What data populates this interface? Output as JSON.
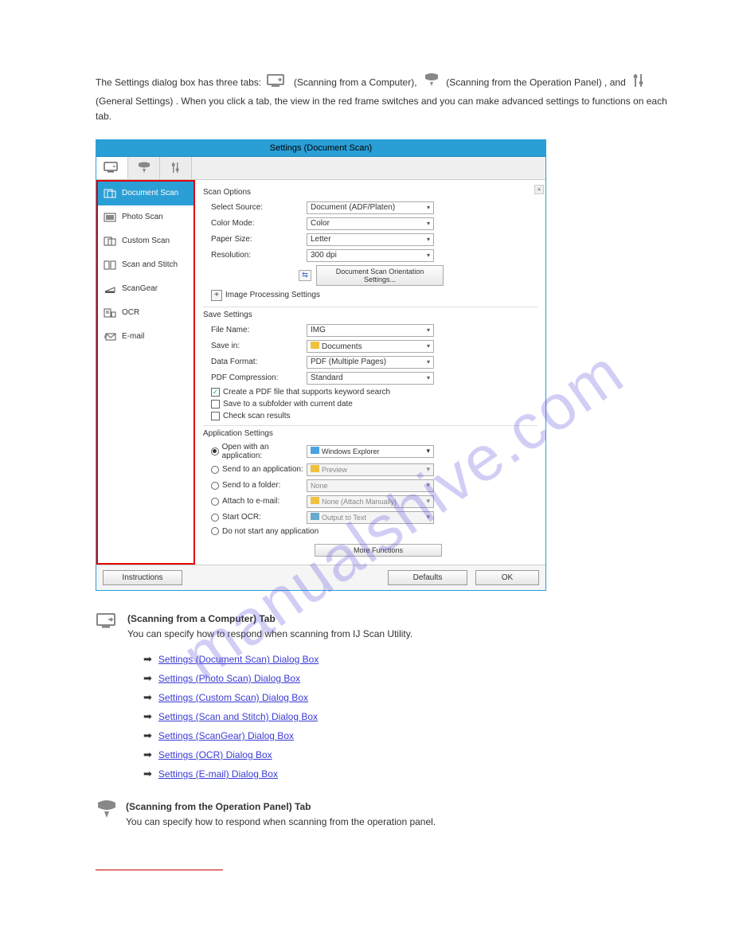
{
  "intro": {
    "text_before": "The Settings dialog box has three tabs:",
    "tab1_label": "(Scanning from a Computer)",
    "tab2_label": "(Scanning from the Operation Panel)",
    "tab3_label": "(General Settings)",
    "text_after": ". When you click a tab, the view in the red frame switches and you can make advanced settings to functions on each tab.",
    "and": ", and"
  },
  "dialog": {
    "title": "Settings (Document Scan)",
    "sidebar": [
      {
        "label": "Document Scan"
      },
      {
        "label": "Photo Scan"
      },
      {
        "label": "Custom Scan"
      },
      {
        "label": "Scan and Stitch"
      },
      {
        "label": "ScanGear"
      },
      {
        "label": "OCR"
      },
      {
        "label": "E-mail"
      }
    ],
    "scan_options": {
      "title": "Scan Options",
      "select_source": {
        "label": "Select Source:",
        "value": "Document (ADF/Platen)"
      },
      "color_mode": {
        "label": "Color Mode:",
        "value": "Color"
      },
      "paper_size": {
        "label": "Paper Size:",
        "value": "Letter"
      },
      "resolution": {
        "label": "Resolution:",
        "value": "300 dpi"
      },
      "orientation_btn": "Document Scan Orientation Settings...",
      "image_proc": "Image Processing Settings"
    },
    "save_settings": {
      "title": "Save Settings",
      "file_name": {
        "label": "File Name:",
        "value": "IMG"
      },
      "save_in": {
        "label": "Save in:",
        "value": "Documents"
      },
      "data_format": {
        "label": "Data Format:",
        "value": "PDF (Multiple Pages)"
      },
      "pdf_compression": {
        "label": "PDF Compression:",
        "value": "Standard"
      },
      "chk_keyword": "Create a PDF file that supports keyword search",
      "chk_subfolder": "Save to a subfolder with current date",
      "chk_results": "Check scan results"
    },
    "app_settings": {
      "title": "Application Settings",
      "open_with": {
        "label": "Open with an application:",
        "value": "Windows Explorer"
      },
      "send_to_app": {
        "label": "Send to an application:",
        "value": "Preview"
      },
      "send_to_folder": {
        "label": "Send to a folder:",
        "value": "None"
      },
      "attach_email": {
        "label": "Attach to e-mail:",
        "value": "None (Attach Manually)"
      },
      "start_ocr": {
        "label": "Start OCR:",
        "value": "Output to Text"
      },
      "do_not_start": "Do not start any application",
      "more_functions": "More Functions"
    },
    "footer": {
      "instructions": "Instructions",
      "defaults": "Defaults",
      "ok": "OK"
    }
  },
  "expl": {
    "tab_comp": {
      "heading": "(Scanning from a Computer) Tab",
      "body": "You can specify how to respond when scanning from IJ Scan Utility."
    },
    "links": [
      "Settings (Document Scan) Dialog Box",
      "Settings (Photo Scan) Dialog Box",
      "Settings (Custom Scan) Dialog Box",
      "Settings (Scan and Stitch) Dialog Box",
      "Settings (ScanGear) Dialog Box",
      "Settings (OCR) Dialog Box",
      "Settings (E-mail) Dialog Box"
    ],
    "tab_panel": {
      "heading": "(Scanning from the Operation Panel) Tab",
      "body": "You can specify how to respond when scanning from the operation panel."
    }
  },
  "watermark": "manualshive.com"
}
